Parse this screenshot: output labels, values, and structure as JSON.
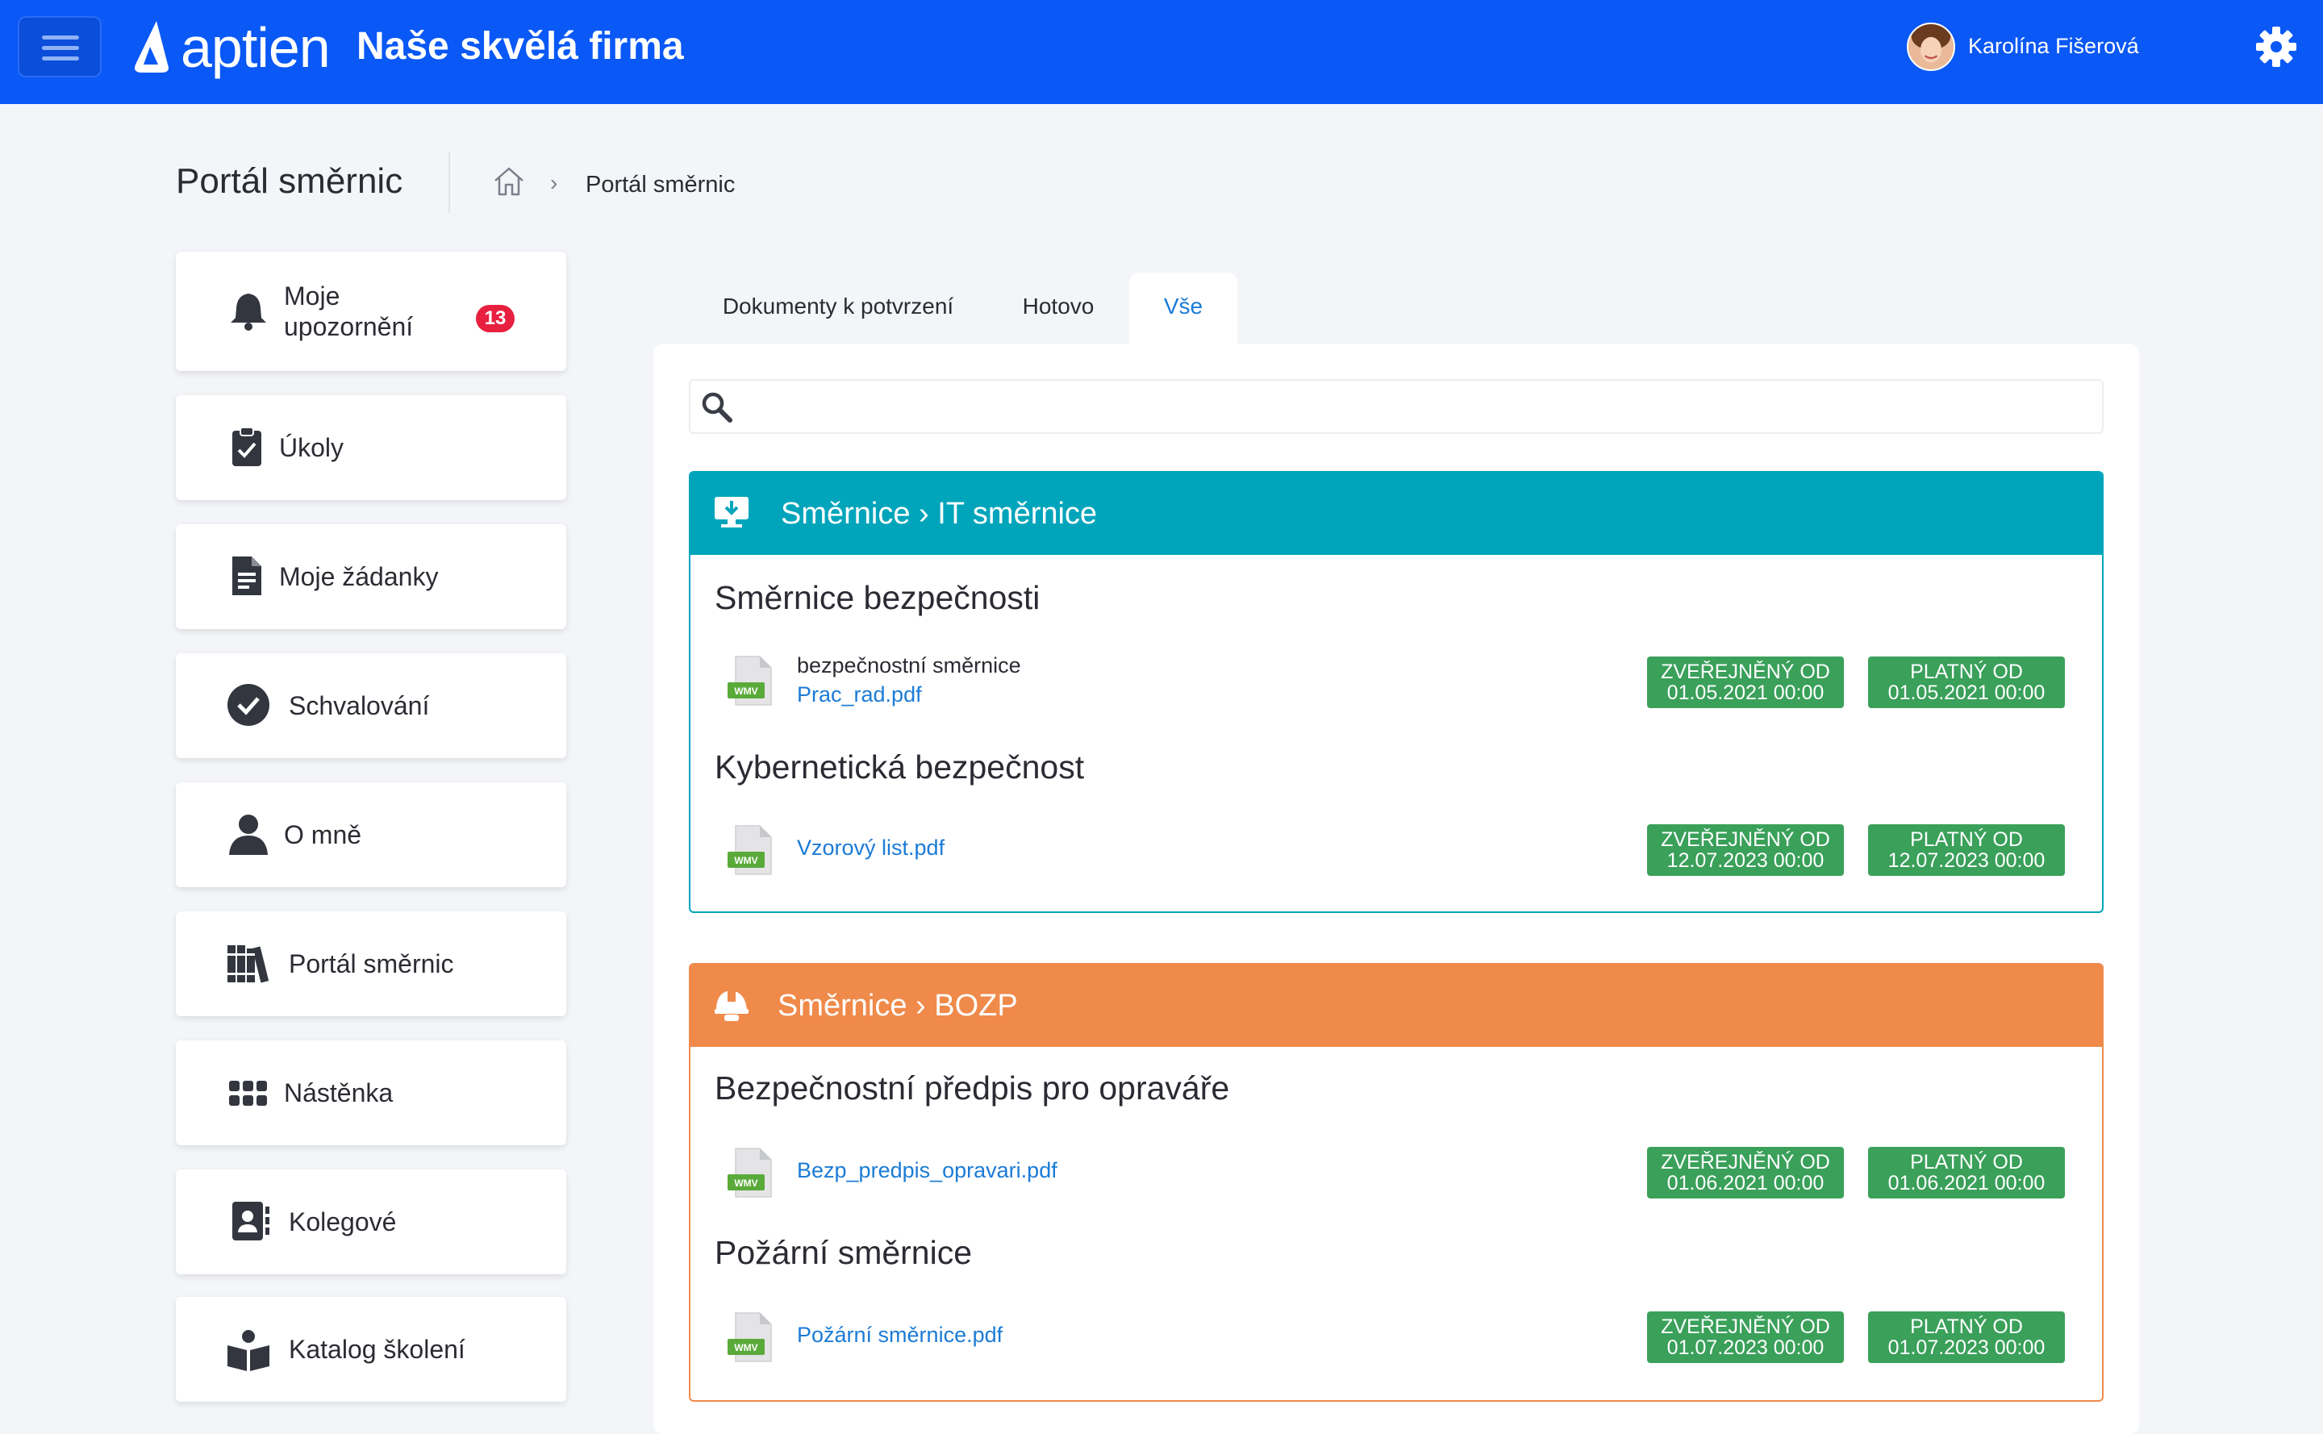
{
  "topbar": {
    "logo_text": "aptien",
    "company": "Naše skvělá firma",
    "user_name": "Karolína Fišerová"
  },
  "header": {
    "page_title": "Portál směrnic",
    "breadcrumb_current": "Portál směrnic"
  },
  "sidebar": {
    "items": [
      {
        "label": "Moje upozornění",
        "badge": "13",
        "icon": "bell-icon"
      },
      {
        "label": "Úkoly",
        "icon": "clipboard-check-icon"
      },
      {
        "label": "Moje žádanky",
        "icon": "document-icon"
      },
      {
        "label": "Schvalování",
        "icon": "check-circle-icon"
      },
      {
        "label": "O mně",
        "icon": "user-icon"
      },
      {
        "label": "Portál směrnic",
        "icon": "books-icon"
      },
      {
        "label": "Nástěnka",
        "icon": "grid-icon"
      },
      {
        "label": "Kolegové",
        "icon": "contacts-icon"
      },
      {
        "label": "Katalog školení",
        "icon": "reader-icon"
      }
    ]
  },
  "tabs": [
    {
      "label": "Dokumenty k potvrzení"
    },
    {
      "label": "Hotovo"
    },
    {
      "label": "Vše",
      "active": true
    }
  ],
  "search": {
    "placeholder": ""
  },
  "groups": [
    {
      "title": "Směrnice › IT směrnice",
      "color": "#00a5bb",
      "icon": "monitor-download-icon",
      "sections": [
        {
          "title": "Směrnice bezpečnosti",
          "file_caption": "bezpečnostní směrnice",
          "file_name": "Prac_rad.pdf",
          "published_label": "ZVEŘEJNĚNÝ OD",
          "published_date": "01.05.2021 00:00",
          "valid_label": "PLATNÝ OD",
          "valid_date": "01.05.2021 00:00"
        },
        {
          "title": "Kybernetická bezpečnost",
          "file_name": "Vzorový list.pdf",
          "published_label": "ZVEŘEJNĚNÝ OD",
          "published_date": "12.07.2023 00:00",
          "valid_label": "PLATNÝ OD",
          "valid_date": "12.07.2023 00:00"
        }
      ]
    },
    {
      "title": "Směrnice › BOZP",
      "color": "#ef8a4a",
      "icon": "helmet-icon",
      "sections": [
        {
          "title": "Bezpečnostní předpis pro opraváře",
          "file_name": "Bezp_predpis_opravari.pdf",
          "published_label": "ZVEŘEJNĚNÝ OD",
          "published_date": "01.06.2021 00:00",
          "valid_label": "PLATNÝ OD",
          "valid_date": "01.06.2021 00:00"
        },
        {
          "title": "Požární směrnice",
          "file_name": "Požární směrnice.pdf",
          "published_label": "ZVEŘEJNĚNÝ OD",
          "published_date": "01.07.2023 00:00",
          "valid_label": "PLATNÝ OD",
          "valid_date": "01.07.2023 00:00"
        }
      ]
    }
  ],
  "file_type_label": "WMV",
  "colors": {
    "brand_blue": "#0a58f5",
    "link": "#1b7bd6",
    "tag_green": "#3aa05a",
    "badge_red": "#e8203f"
  }
}
